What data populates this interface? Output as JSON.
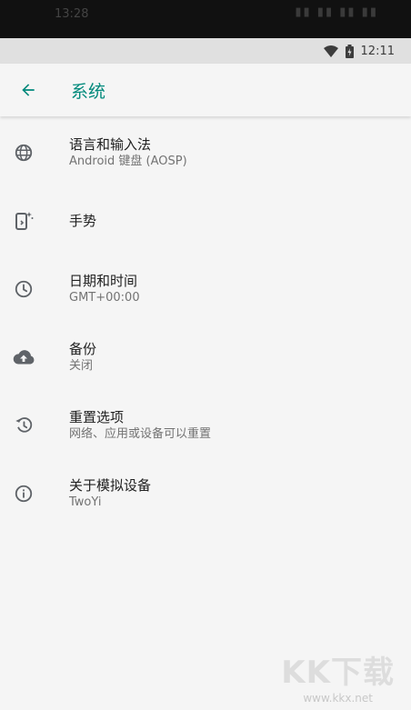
{
  "status_bar": {
    "time": "12:11"
  },
  "app_bar": {
    "title": "系统"
  },
  "settings": [
    {
      "icon": "language-globe-icon",
      "title": "语言和输入法",
      "summary": "Android 键盘 (AOSP)"
    },
    {
      "icon": "gestures-icon",
      "title": "手势",
      "summary": ""
    },
    {
      "icon": "clock-icon",
      "title": "日期和时间",
      "summary": "GMT+00:00"
    },
    {
      "icon": "cloud-upload-icon",
      "title": "备份",
      "summary": "关闭"
    },
    {
      "icon": "restore-history-icon",
      "title": "重置选项",
      "summary": "网络、应用或设备可以重置"
    },
    {
      "icon": "info-icon",
      "title": "关于模拟设备",
      "summary": "TwoYi"
    }
  ],
  "watermark": {
    "logo": "KK下载",
    "url": "www.kkx.net"
  },
  "colors": {
    "accent": "#00897b",
    "icon": "#5f6368",
    "background": "#f5f5f5"
  }
}
